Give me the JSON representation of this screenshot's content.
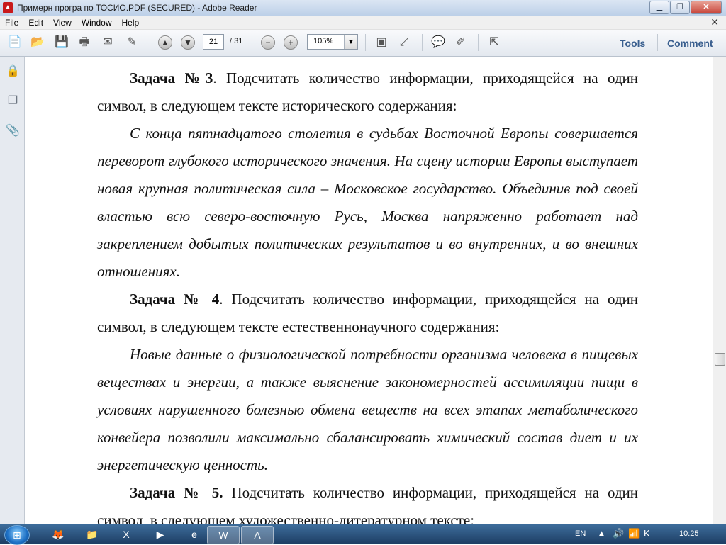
{
  "window": {
    "title": "Примерн програ по ТОСИО.PDF (SECURED) - Adobe Reader",
    "app_icon": "adobe-reader-icon"
  },
  "menu": [
    "File",
    "Edit",
    "View",
    "Window",
    "Help"
  ],
  "toolbar": {
    "page_current": "21",
    "page_total": "/ 31",
    "zoom": "105%",
    "tools_label": "Tools",
    "comment_label": "Comment"
  },
  "document": {
    "t3_label": "Задача №3",
    "t3_text": ". Подсчитать количество информации, приходящейся на один символ, в следующем тексте исторического содержания:",
    "t3_quote": "С конца пятнадцатого столетия в судьбах Восточной Европы совершается переворот глубокого исторического значения. На сцену истории Европы выступает новая крупная политическая сила – Московское государство. Объединив под своей властью всю северо-восточную Русь, Москва напряженно работает над закреплением добытых политических результатов и во внутренних, и во внешних отношениях.",
    "t4_label": "Задача № 4",
    "t4_text": ". Подсчитать количество информации, приходящейся на один символ, в следующем тексте естественнонаучного содержания:",
    "t4_quote": "Новые данные о физиологической потребности организма человека в пищевых веществах и энергии, а также выяснение закономерностей ассимиляции пищи в условиях нарушенного болезнью обмена веществ на всех этапах метаболического конвейера позволили максимально сбалансировать химический состав диет и их энергетическую ценность.",
    "t5_label": "Задача № 5.",
    "t5_text": " Подсчитать количество информации, приходящейся на один символ, в следующем художественно-литературном тексте:"
  },
  "taskbar": {
    "language": "EN",
    "time": "10:25"
  },
  "colors": {
    "accent_link": "#3a5f8f",
    "adobe_red": "#c8191b"
  }
}
